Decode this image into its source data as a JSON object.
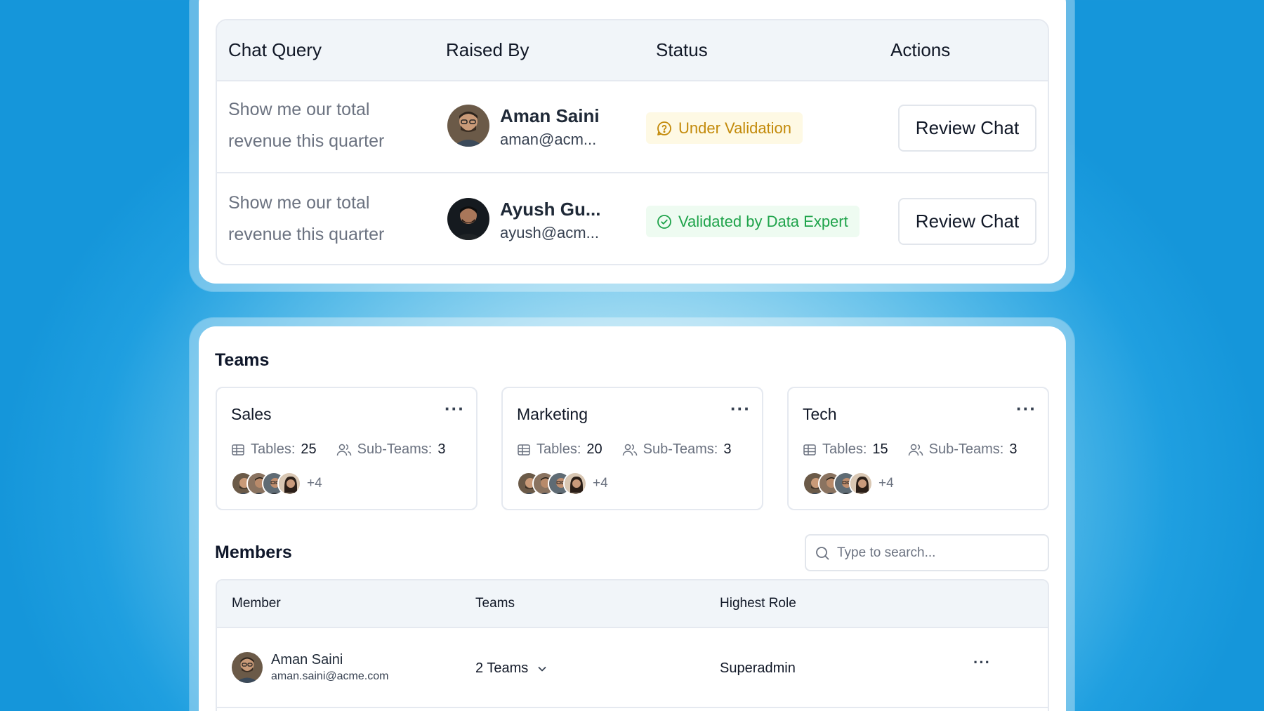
{
  "chat_queries": {
    "headers": {
      "query": "Chat Query",
      "raised_by": "Raised By",
      "status": "Status",
      "actions": "Actions"
    },
    "rows": [
      {
        "query": "Show me our total revenue this quarter",
        "name": "Aman Saini",
        "email": "aman@acm...",
        "status": "Under Validation",
        "action": "Review Chat"
      },
      {
        "query": "Show me our total revenue this quarter",
        "name": "Ayush Gu...",
        "email": "ayush@acm...",
        "status": "Validated by Data Expert",
        "action": "Review Chat"
      }
    ]
  },
  "teams": {
    "title": "Teams",
    "tables_label": "Tables:",
    "subteams_label": "Sub-Teams:",
    "items": [
      {
        "name": "Sales",
        "tables": "25",
        "subteams": "3",
        "more_members": "+4"
      },
      {
        "name": "Marketing",
        "tables": "20",
        "subteams": "3",
        "more_members": "+4"
      },
      {
        "name": "Tech",
        "tables": "15",
        "subteams": "3",
        "more_members": "+4"
      }
    ]
  },
  "members": {
    "title": "Members",
    "search_placeholder": "Type to search...",
    "headers": {
      "member": "Member",
      "teams": "Teams",
      "role": "Highest Role"
    },
    "rows": [
      {
        "name": "Aman Saini",
        "email": "aman.saini@acme.com",
        "teams": "2 Teams",
        "role": "Superadmin"
      }
    ]
  },
  "colors": {
    "accent_bg": "#1596da",
    "warn": "#c38a0a",
    "success": "#1ea34a"
  }
}
